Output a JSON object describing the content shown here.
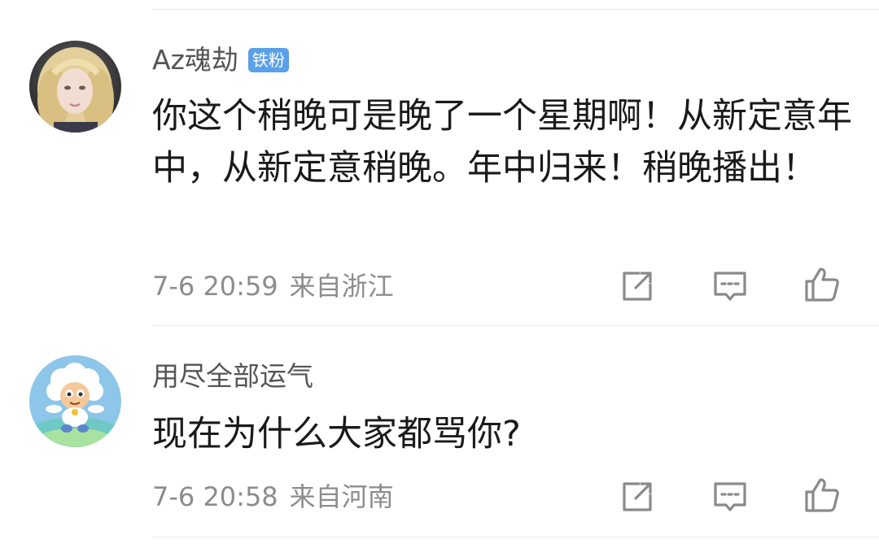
{
  "comments": [
    {
      "username": "Az魂劫",
      "badge": "铁粉",
      "text": "你这个稍晚可是晚了一个星期啊！从新定意年中，从新定意稍晚。年中归来！稍晚播出！",
      "time": "7-6 20:59",
      "location": "来自浙江",
      "avatar_icon": "blonde-woman-avatar",
      "actions": [
        "share-icon",
        "reply-icon",
        "like-icon"
      ]
    },
    {
      "username": "用尽全部运气",
      "badge": "",
      "text": "现在为什么大家都骂你?",
      "time": "7-6 20:58",
      "location": "来自河南",
      "avatar_icon": "lazy-sheep-avatar",
      "actions": [
        "share-icon",
        "reply-icon",
        "like-icon"
      ]
    }
  ],
  "colors": {
    "badge_bg": "#5aa0e8",
    "username": "#555555",
    "text": "#1a1a1a",
    "meta": "#8c8c8c",
    "icon": "#8a8a8a",
    "divider": "#ececec"
  }
}
